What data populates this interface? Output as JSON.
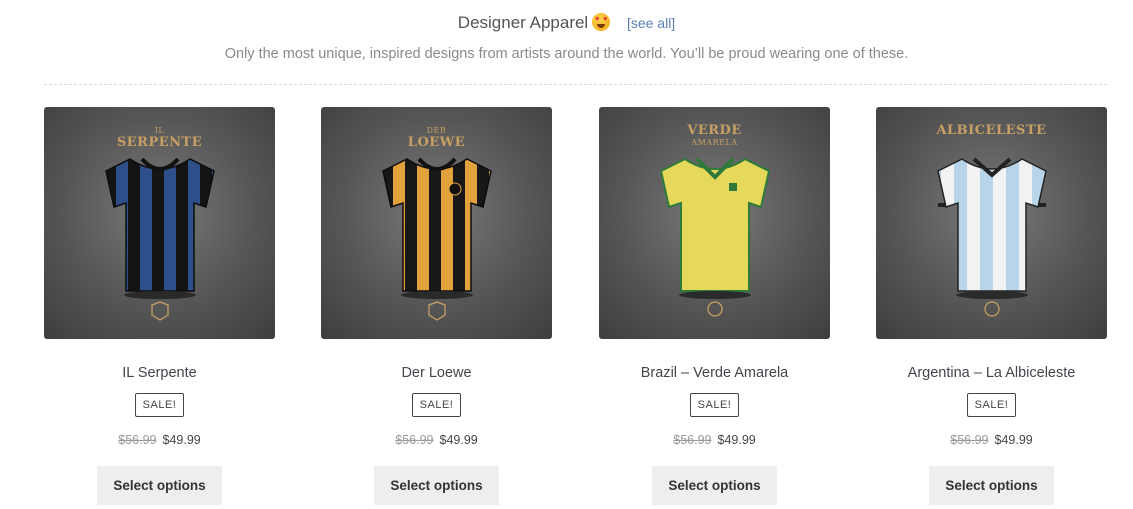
{
  "section": {
    "title": "Designer Apparel",
    "emoji_icon": "heart-eyes-emoji-icon",
    "see_all": "[see all]",
    "subtitle": "Only the most unique, inspired designs from artists around the world. You’ll be proud wearing one of these."
  },
  "products": [
    {
      "name": "IL Serpente",
      "brand_line1": "IL",
      "brand_line2": "SERPENTE",
      "sale_badge": "SALE!",
      "old_price": "$56.99",
      "price": "$49.99",
      "button": "Select options",
      "colors": {
        "a": "#2d4f8a",
        "b": "#151515"
      }
    },
    {
      "name": "Der Loewe",
      "brand_line1": "DER",
      "brand_line2": "LOEWE",
      "sale_badge": "SALE!",
      "old_price": "$56.99",
      "price": "$49.99",
      "button": "Select options",
      "colors": {
        "a": "#e1a13b",
        "b": "#171717"
      }
    },
    {
      "name": "Brazil – Verde Amarela",
      "brand_line1": "VERDE",
      "brand_line2": "AMARELA",
      "sale_badge": "SALE!",
      "old_price": "$56.99",
      "price": "$49.99",
      "button": "Select options",
      "colors": {
        "a": "#e6d85a",
        "b": "#e6d85a"
      }
    },
    {
      "name": "Argentina – La Albiceleste",
      "brand_line1": "",
      "brand_line2": "ALBICELESTE",
      "sale_badge": "SALE!",
      "old_price": "$56.99",
      "price": "$49.99",
      "button": "Select options",
      "colors": {
        "a": "#b7d4e8",
        "b": "#f2f2f2"
      }
    }
  ]
}
